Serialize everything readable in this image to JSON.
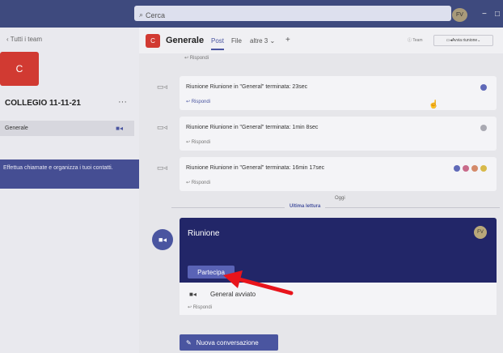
{
  "topbar": {
    "search_placeholder": "Cerca",
    "avatar_initials": "FV",
    "window_controls": [
      "−",
      "□"
    ]
  },
  "sidebar": {
    "back_label": "Tutti i team",
    "team_initial": "C",
    "team_name": "COLLEGIO 11-11-21",
    "more_label": "···",
    "channel_name": "Generale",
    "promo_text": "Effettua chiamate e organizza i tuoi contatti."
  },
  "channel_header": {
    "initial": "C",
    "title": "Generale",
    "tabs": [
      "Post",
      "File",
      "altre 3 ⌄",
      "+"
    ],
    "team_label": "Team",
    "meet_button": "Avvia riunione"
  },
  "feed": {
    "reply_label": "Rispondi",
    "posts": [
      {
        "text": "Riunione Riunione in \"General\" terminata: 23sec",
        "reply": "Rispondi"
      },
      {
        "text": "Riunione Riunione in \"General\" terminata: 1min 8sec",
        "reply": "Rispondi"
      },
      {
        "text": "Riunione Riunione in \"General\" terminata: 16min 17sec",
        "reply": "Rispondi"
      }
    ],
    "today_label": "Oggi",
    "last_read_label": "Ultima lettura",
    "meeting": {
      "title": "Riunione",
      "avatar_initials": "FV",
      "join_button": "Partecipa",
      "status_text": "General avviato",
      "reply": "Rispondi"
    },
    "new_conversation_button": "Nuova conversazione"
  },
  "colors": {
    "accent": "#4a55a0",
    "meeting_card": "#222668",
    "topbar": "#3e4a7e",
    "team_tile": "#d13a32",
    "annotation_arrow": "#e8141c"
  }
}
